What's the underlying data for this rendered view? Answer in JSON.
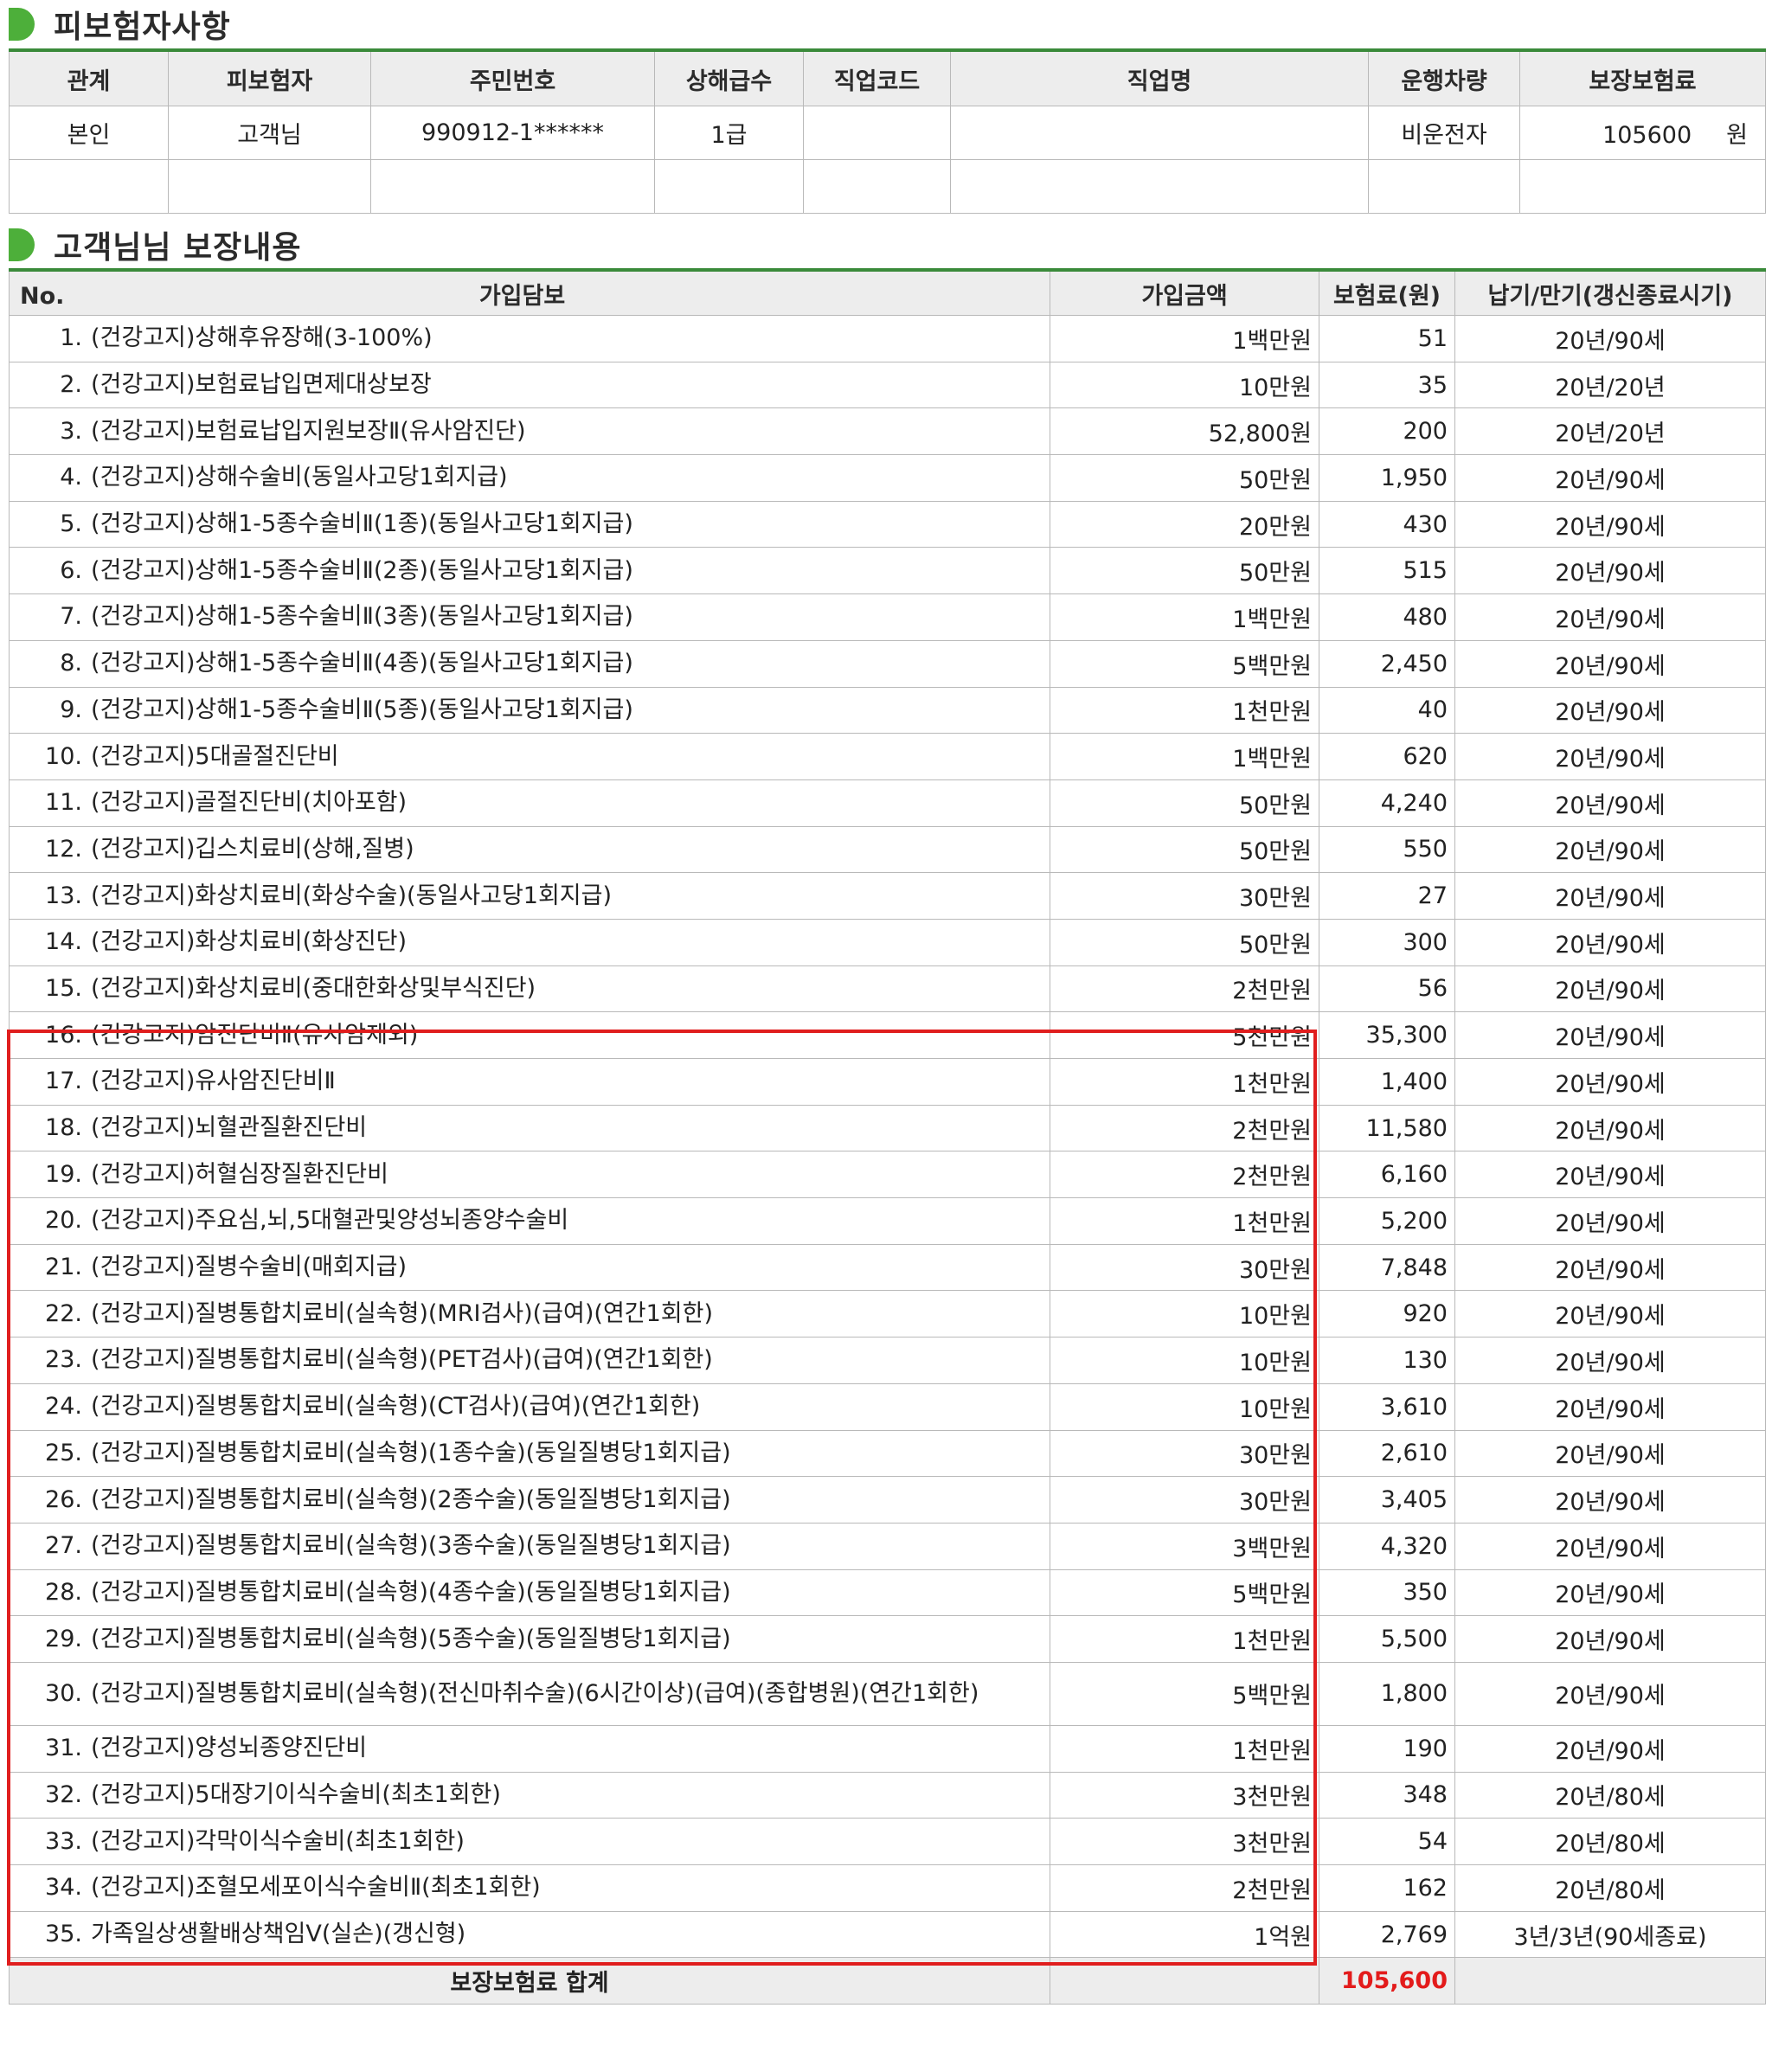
{
  "insured_section": {
    "title": "피보험자사항",
    "headers": [
      "관계",
      "피보험자",
      "주민번호",
      "상해급수",
      "직업코드",
      "직업명",
      "운행차량",
      "보장보험료"
    ],
    "row": {
      "relation": "본인",
      "insured": "고객님",
      "resident_no": "990912-1******",
      "injury_grade": "1급",
      "job_code": "",
      "job_name": "",
      "vehicle": "비운전자",
      "premium": "105600",
      "premium_unit": "원"
    }
  },
  "coverage_section": {
    "title": "고객님님 보장내용",
    "headers": [
      "No.",
      "가입담보",
      "가입금액",
      "보험료(원)",
      "납기/만기(갱신종료시기)"
    ],
    "items": [
      {
        "no": "1.",
        "name": "(건강고지)상해후유장해(3-100%)",
        "amount": "1백만원",
        "premium": "51",
        "term": "20년/90세"
      },
      {
        "no": "2.",
        "name": "(건강고지)보험료납입면제대상보장",
        "amount": "10만원",
        "premium": "35",
        "term": "20년/20년"
      },
      {
        "no": "3.",
        "name": "(건강고지)보험료납입지원보장Ⅱ(유사암진단)",
        "amount": "52,800원",
        "premium": "200",
        "term": "20년/20년"
      },
      {
        "no": "4.",
        "name": "(건강고지)상해수술비(동일사고당1회지급)",
        "amount": "50만원",
        "premium": "1,950",
        "term": "20년/90세"
      },
      {
        "no": "5.",
        "name": "(건강고지)상해1-5종수술비Ⅱ(1종)(동일사고당1회지급)",
        "amount": "20만원",
        "premium": "430",
        "term": "20년/90세"
      },
      {
        "no": "6.",
        "name": "(건강고지)상해1-5종수술비Ⅱ(2종)(동일사고당1회지급)",
        "amount": "50만원",
        "premium": "515",
        "term": "20년/90세"
      },
      {
        "no": "7.",
        "name": "(건강고지)상해1-5종수술비Ⅱ(3종)(동일사고당1회지급)",
        "amount": "1백만원",
        "premium": "480",
        "term": "20년/90세"
      },
      {
        "no": "8.",
        "name": "(건강고지)상해1-5종수술비Ⅱ(4종)(동일사고당1회지급)",
        "amount": "5백만원",
        "premium": "2,450",
        "term": "20년/90세"
      },
      {
        "no": "9.",
        "name": "(건강고지)상해1-5종수술비Ⅱ(5종)(동일사고당1회지급)",
        "amount": "1천만원",
        "premium": "40",
        "term": "20년/90세"
      },
      {
        "no": "10.",
        "name": "(건강고지)5대골절진단비",
        "amount": "1백만원",
        "premium": "620",
        "term": "20년/90세"
      },
      {
        "no": "11.",
        "name": "(건강고지)골절진단비(치아포함)",
        "amount": "50만원",
        "premium": "4,240",
        "term": "20년/90세"
      },
      {
        "no": "12.",
        "name": "(건강고지)깁스치료비(상해,질병)",
        "amount": "50만원",
        "premium": "550",
        "term": "20년/90세"
      },
      {
        "no": "13.",
        "name": "(건강고지)화상치료비(화상수술)(동일사고당1회지급)",
        "amount": "30만원",
        "premium": "27",
        "term": "20년/90세"
      },
      {
        "no": "14.",
        "name": "(건강고지)화상치료비(화상진단)",
        "amount": "50만원",
        "premium": "300",
        "term": "20년/90세"
      },
      {
        "no": "15.",
        "name": "(건강고지)화상치료비(중대한화상및부식진단)",
        "amount": "2천만원",
        "premium": "56",
        "term": "20년/90세"
      },
      {
        "no": "16.",
        "name": "(건강고지)암진단비Ⅱ(유사암제외)",
        "amount": "5천만원",
        "premium": "35,300",
        "term": "20년/90세"
      },
      {
        "no": "17.",
        "name": "(건강고지)유사암진단비Ⅱ",
        "amount": "1천만원",
        "premium": "1,400",
        "term": "20년/90세"
      },
      {
        "no": "18.",
        "name": "(건강고지)뇌혈관질환진단비",
        "amount": "2천만원",
        "premium": "11,580",
        "term": "20년/90세"
      },
      {
        "no": "19.",
        "name": "(건강고지)허혈심장질환진단비",
        "amount": "2천만원",
        "premium": "6,160",
        "term": "20년/90세"
      },
      {
        "no": "20.",
        "name": "(건강고지)주요심,뇌,5대혈관및양성뇌종양수술비",
        "amount": "1천만원",
        "premium": "5,200",
        "term": "20년/90세"
      },
      {
        "no": "21.",
        "name": "(건강고지)질병수술비(매회지급)",
        "amount": "30만원",
        "premium": "7,848",
        "term": "20년/90세"
      },
      {
        "no": "22.",
        "name": "(건강고지)질병통합치료비(실속형)(MRI검사)(급여)(연간1회한)",
        "amount": "10만원",
        "premium": "920",
        "term": "20년/90세"
      },
      {
        "no": "23.",
        "name": "(건강고지)질병통합치료비(실속형)(PET검사)(급여)(연간1회한)",
        "amount": "10만원",
        "premium": "130",
        "term": "20년/90세"
      },
      {
        "no": "24.",
        "name": "(건강고지)질병통합치료비(실속형)(CT검사)(급여)(연간1회한)",
        "amount": "10만원",
        "premium": "3,610",
        "term": "20년/90세"
      },
      {
        "no": "25.",
        "name": "(건강고지)질병통합치료비(실속형)(1종수술)(동일질병당1회지급)",
        "amount": "30만원",
        "premium": "2,610",
        "term": "20년/90세"
      },
      {
        "no": "26.",
        "name": "(건강고지)질병통합치료비(실속형)(2종수술)(동일질병당1회지급)",
        "amount": "30만원",
        "premium": "3,405",
        "term": "20년/90세"
      },
      {
        "no": "27.",
        "name": "(건강고지)질병통합치료비(실속형)(3종수술)(동일질병당1회지급)",
        "amount": "3백만원",
        "premium": "4,320",
        "term": "20년/90세"
      },
      {
        "no": "28.",
        "name": "(건강고지)질병통합치료비(실속형)(4종수술)(동일질병당1회지급)",
        "amount": "5백만원",
        "premium": "350",
        "term": "20년/90세"
      },
      {
        "no": "29.",
        "name": "(건강고지)질병통합치료비(실속형)(5종수술)(동일질병당1회지급)",
        "amount": "1천만원",
        "premium": "5,500",
        "term": "20년/90세"
      },
      {
        "no": "30.",
        "name": "(건강고지)질병통합치료비(실속형)(전신마취수술)(6시간이상)(급여)(종합병원)(연간1회한)",
        "amount": "5백만원",
        "premium": "1,800",
        "term": "20년/90세"
      },
      {
        "no": "31.",
        "name": "(건강고지)양성뇌종양진단비",
        "amount": "1천만원",
        "premium": "190",
        "term": "20년/90세"
      },
      {
        "no": "32.",
        "name": "(건강고지)5대장기이식수술비(최초1회한)",
        "amount": "3천만원",
        "premium": "348",
        "term": "20년/80세"
      },
      {
        "no": "33.",
        "name": "(건강고지)각막이식수술비(최초1회한)",
        "amount": "3천만원",
        "premium": "54",
        "term": "20년/80세"
      },
      {
        "no": "34.",
        "name": "(건강고지)조혈모세포이식수술비Ⅱ(최초1회한)",
        "amount": "2천만원",
        "premium": "162",
        "term": "20년/80세"
      },
      {
        "no": "35.",
        "name": "가족일상생활배상책임Ⅴ(실손)(갱신형)",
        "amount": "1억원",
        "premium": "2,769",
        "term": "3년/3년(90세종료)"
      }
    ],
    "total": {
      "label": "보장보험료 합계",
      "value": "105,600"
    },
    "highlight_color": "#e01e1e",
    "accent_color": "#4daf3a"
  }
}
